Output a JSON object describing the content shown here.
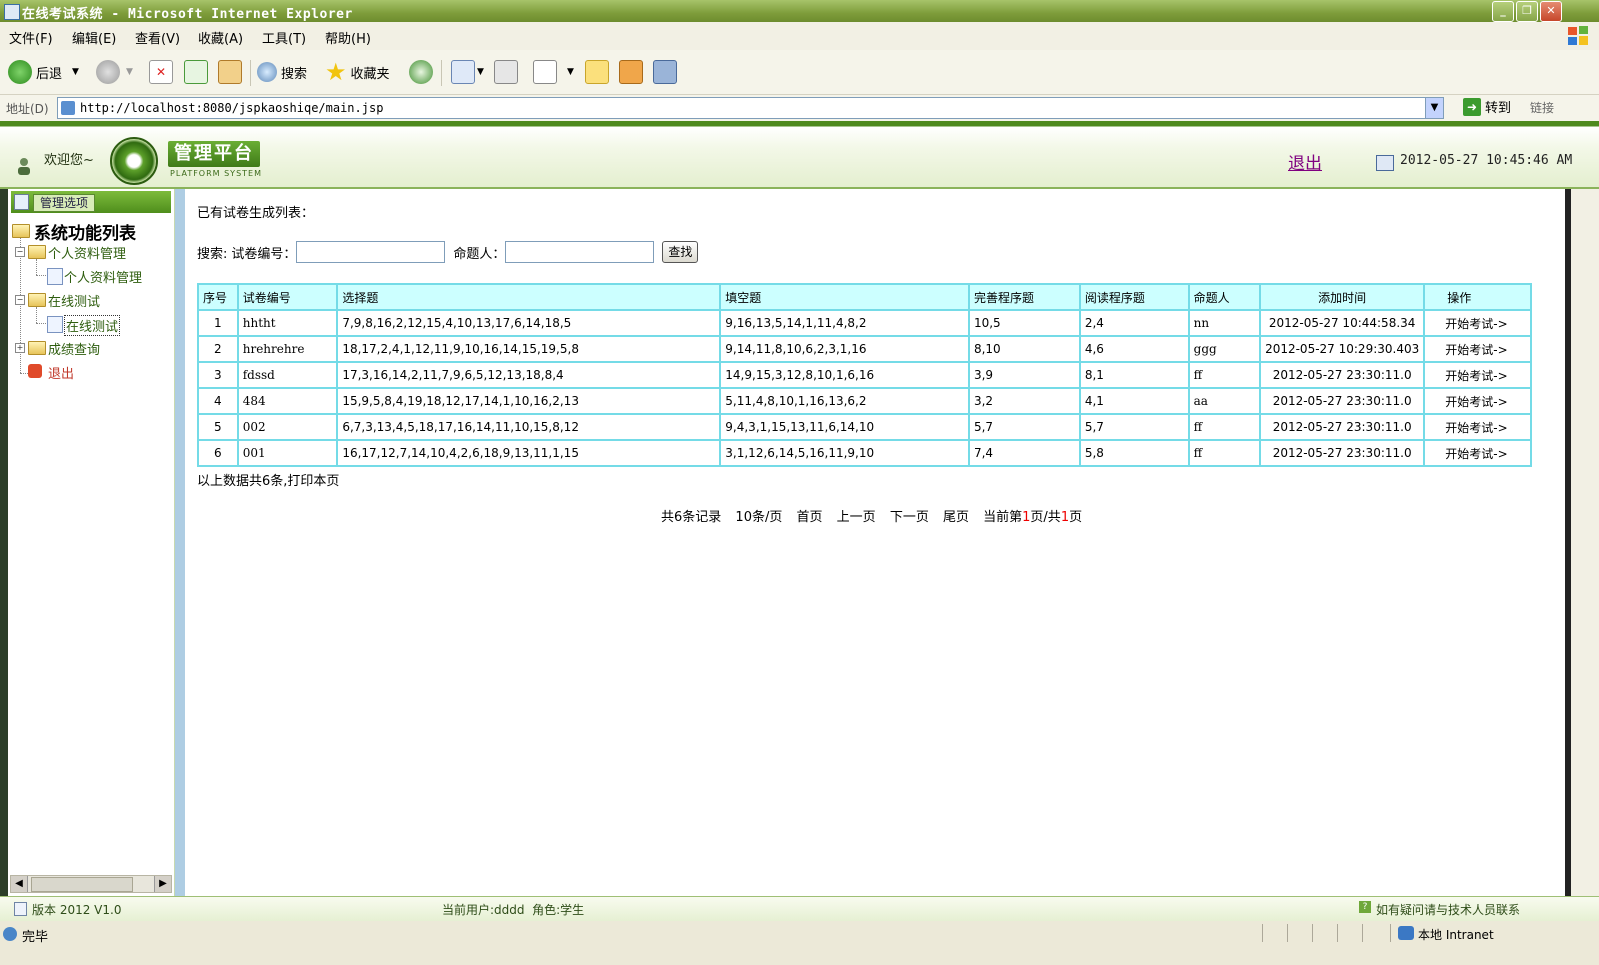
{
  "window": {
    "title": "在线考试系统 - Microsoft Internet Explorer",
    "controls": [
      "_",
      "❐",
      "✕"
    ]
  },
  "menu": [
    "文件(F)",
    "编辑(E)",
    "查看(V)",
    "收藏(A)",
    "工具(T)",
    "帮助(H)"
  ],
  "toolbar": {
    "back": "后退",
    "search": "搜索",
    "favorites": "收藏夹"
  },
  "address": {
    "label": "地址(D)",
    "url": "http://localhost:8080/jspkaoshiqe/main.jsp",
    "go": "转到",
    "links": "链接"
  },
  "header": {
    "welcome": "欢迎您~",
    "platform": "管理平台",
    "platform_sub": "PLATFORM SYSTEM",
    "logout": "退出",
    "datetime": "2012-05-27 10:45:46 AM"
  },
  "sidebar": {
    "tab": "管理选项",
    "title": "系统功能列表",
    "tree": [
      {
        "label": "个人资料管理",
        "children": [
          "个人资料管理"
        ]
      },
      {
        "label": "在线测试",
        "children": [
          "在线测试"
        ]
      },
      {
        "label": "成绩查询",
        "children": []
      }
    ],
    "exit": "退出"
  },
  "main": {
    "list_title": "已有试卷生成列表：",
    "search": {
      "label": "搜索:",
      "field1": "试卷编号：",
      "field2": "命题人：",
      "button": "查找",
      "value1": "",
      "value2": ""
    },
    "columns": [
      "序号",
      "试卷编号",
      "选择题",
      "填空题",
      "完善程序题",
      "阅读程序题",
      "命题人",
      "添加时间",
      "操作"
    ],
    "rows": [
      [
        "1",
        "hhtht",
        "7,9,8,16,2,12,15,4,10,13,17,6,14,18,5",
        "9,16,13,5,14,1,11,4,8,2",
        "10,5",
        "2,4",
        "nn",
        "2012-05-27 10:44:58.34",
        "开始考试->"
      ],
      [
        "2",
        "hrehrehre",
        "18,17,2,4,1,12,11,9,10,16,14,15,19,5,8",
        "9,14,11,8,10,6,2,3,1,16",
        "8,10",
        "4,6",
        "ggg",
        "2012-05-27 10:29:30.403",
        "开始考试->"
      ],
      [
        "3",
        "fdssd",
        "17,3,16,14,2,11,7,9,6,5,12,13,18,8,4",
        "14,9,15,3,12,8,10,1,6,16",
        "3,9",
        "8,1",
        "ff",
        "2012-05-27 23:30:11.0",
        "开始考试->"
      ],
      [
        "4",
        "484",
        "15,9,5,8,4,19,18,12,17,14,1,10,16,2,13",
        "5,11,4,8,10,1,16,13,6,2",
        "3,2",
        "4,1",
        "aa",
        "2012-05-27 23:30:11.0",
        "开始考试->"
      ],
      [
        "5",
        "002",
        "6,7,3,13,4,5,18,17,16,14,11,10,15,8,12",
        "9,4,3,1,15,13,11,6,14,10",
        "5,7",
        "5,7",
        "ff",
        "2012-05-27 23:30:11.0",
        "开始考试->"
      ],
      [
        "6",
        "001",
        "16,17,12,7,14,10,4,2,6,18,9,13,11,1,15",
        "3,1,12,6,14,5,16,11,9,10",
        "7,4",
        "5,8",
        "ff",
        "2012-05-27 23:30:11.0",
        "开始考试->"
      ]
    ],
    "summary": "以上数据共6条,打印本页",
    "pager": {
      "total": "共6条记录",
      "per_page": "10条/页",
      "first": "首页",
      "prev": "上一页",
      "next": "下一页",
      "last": "尾页",
      "current_prefix": "当前第",
      "current_page": "1",
      "current_mid": "页/共",
      "total_pages": "1",
      "current_suffix": "页"
    }
  },
  "footer": {
    "version": "版本 2012 V1.0",
    "user": "当前用户:dddd  角色:学生",
    "help": "如有疑问请与技术人员联系"
  },
  "status": {
    "text": "完毕",
    "zone": "本地 Intranet"
  }
}
